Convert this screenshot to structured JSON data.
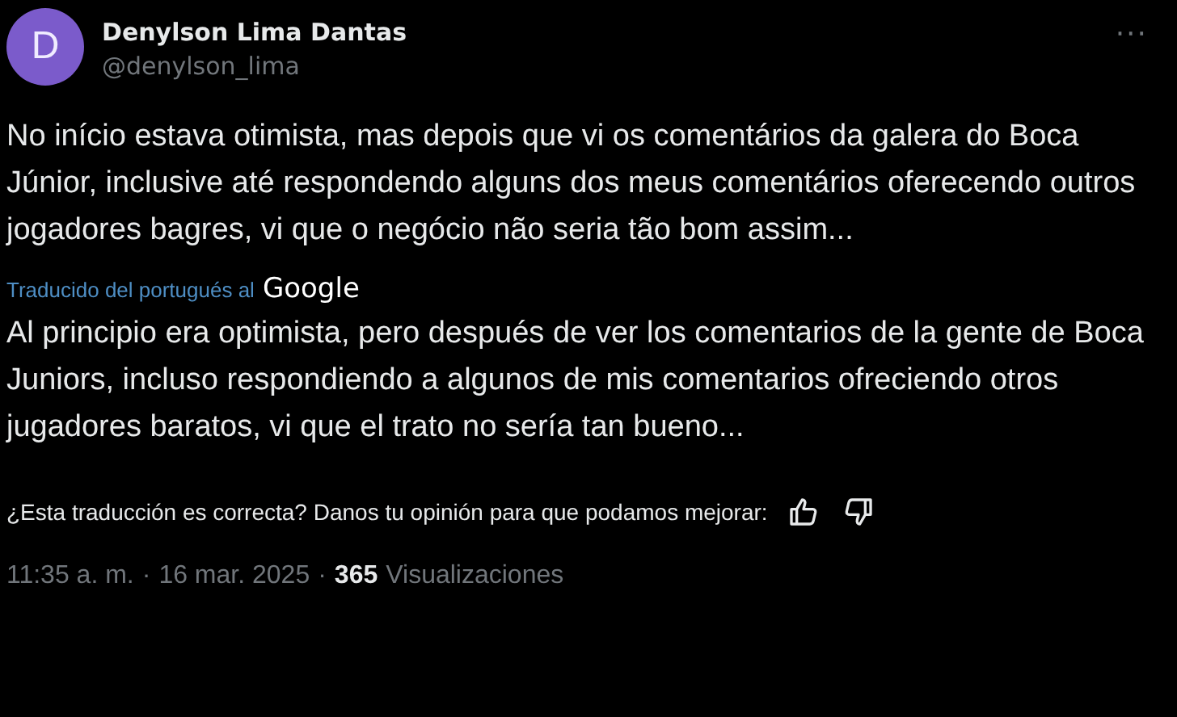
{
  "author": {
    "initial": "D",
    "name": "Denylson Lima Dantas",
    "handle": "@denylson_lima"
  },
  "more": "···",
  "text": "No início estava otimista, mas depois que vi os comentários da galera do Boca Júnior, inclusive até respondendo alguns dos meus comentários oferecendo outros jogadores bagres, vi que o negócio não seria tão bom assim...",
  "translation": {
    "label": "Traducido del portugués al",
    "provider": "Google",
    "text": "Al principio era optimista, pero después de ver los comentarios de la gente de Boca Juniors, incluso respondiendo a algunos de mis comentarios ofreciendo otros jugadores baratos, vi que el trato no sería tan bueno..."
  },
  "feedback": "¿Esta traducción es correcta? Danos tu opinión para que podamos mejorar:",
  "footer": {
    "separator": "·",
    "time": "11:35 a. m.",
    "date": "16 mar. 2025",
    "views": "365",
    "views_label": "Visualizaciones"
  }
}
